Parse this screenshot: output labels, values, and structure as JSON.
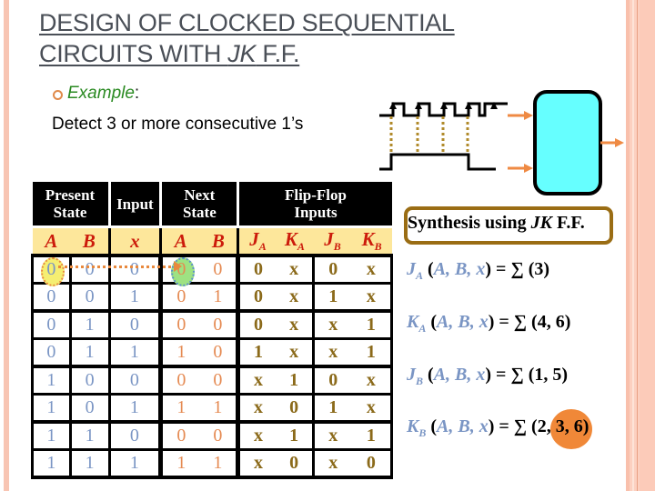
{
  "slide": {
    "title_line1": "DESIGN OF CLOCKED SEQUENTIAL",
    "title_line2_prefix": "CIRCUITS WITH ",
    "title_line2_italic": "JK",
    "title_line2_suffix": " F.F.",
    "example_label": "Example",
    "example_colon": ":",
    "example_text": "Detect 3 or more consecutive 1’s"
  },
  "table": {
    "headers": [
      "Present State",
      "Input",
      "Next State",
      "Flip-Flop Inputs"
    ],
    "header_lines": {
      "present_1": "Present",
      "present_2": "State",
      "input": "Input",
      "next_1": "Next",
      "next_2": "State",
      "ff_1": "Flip-Flop",
      "ff_2": "Inputs"
    },
    "subheaders": {
      "ps_a": "A",
      "ps_b": "B",
      "x": "x",
      "ns_a": "A",
      "ns_b": "B",
      "ja": "J",
      "ja_sub": "A",
      "ka": "K",
      "ka_sub": "A",
      "jb": "J",
      "jb_sub": "B",
      "kb": "K",
      "kb_sub": "B"
    },
    "rows": [
      {
        "A": "0",
        "B": "0",
        "x": "0",
        "nA": "0",
        "nB": "0",
        "JA": "0",
        "KA": "x",
        "JB": "0",
        "KB": "x"
      },
      {
        "A": "0",
        "B": "0",
        "x": "1",
        "nA": "0",
        "nB": "1",
        "JA": "0",
        "KA": "x",
        "JB": "1",
        "KB": "x"
      },
      {
        "A": "0",
        "B": "1",
        "x": "0",
        "nA": "0",
        "nB": "0",
        "JA": "0",
        "KA": "x",
        "JB": "x",
        "KB": "1"
      },
      {
        "A": "0",
        "B": "1",
        "x": "1",
        "nA": "1",
        "nB": "0",
        "JA": "1",
        "KA": "x",
        "JB": "x",
        "KB": "1"
      },
      {
        "A": "1",
        "B": "0",
        "x": "0",
        "nA": "0",
        "nB": "0",
        "JA": "x",
        "KA": "1",
        "JB": "0",
        "KB": "x"
      },
      {
        "A": "1",
        "B": "0",
        "x": "1",
        "nA": "1",
        "nB": "1",
        "JA": "x",
        "KA": "0",
        "JB": "1",
        "KB": "x"
      },
      {
        "A": "1",
        "B": "1",
        "x": "0",
        "nA": "0",
        "nB": "0",
        "JA": "x",
        "KA": "1",
        "JB": "x",
        "KB": "1"
      },
      {
        "A": "1",
        "B": "1",
        "x": "1",
        "nA": "1",
        "nB": "1",
        "JA": "x",
        "KA": "0",
        "JB": "x",
        "KB": "0"
      }
    ]
  },
  "synthesis": {
    "title_prefix": "Synthesis using ",
    "title_italic": "JK",
    "title_suffix": " F.F.",
    "equations": [
      {
        "fn": "J",
        "sub": "A",
        "args": "A, B, x",
        "rhs_prefix": " = ∑ (",
        "rhs_plain": "3",
        "rhs_hl": "",
        "rhs_suffix": ")"
      },
      {
        "fn": "K",
        "sub": "A",
        "args": "A, B, x",
        "rhs_prefix": " = ∑ (",
        "rhs_plain": "4, 6",
        "rhs_hl": "",
        "rhs_suffix": ")"
      },
      {
        "fn": "J",
        "sub": "B",
        "args": "A, B, x",
        "rhs_prefix": " = ∑ (",
        "rhs_plain": "1, 5",
        "rhs_hl": "",
        "rhs_suffix": ")"
      },
      {
        "fn": "K",
        "sub": "B",
        "args": "A, B, x",
        "rhs_prefix": " = ∑ (",
        "rhs_plain": "2, ",
        "rhs_hl": "3, 6",
        "rhs_suffix": ")"
      }
    ]
  },
  "colors": {
    "title": "#4a4f57",
    "example_green": "#2a8a22",
    "header_black": "#000000",
    "subheader_yellow": "#fde79b",
    "subheader_red": "#cc1b0b",
    "present_state_blue": "#7a95c4",
    "next_state_orange": "#e58a52",
    "ff_gold": "#8b6a1a",
    "circuit_cyan": "#66ffff",
    "arrow_orange": "#ef8a43",
    "border_pink": "#f8c5b3"
  }
}
